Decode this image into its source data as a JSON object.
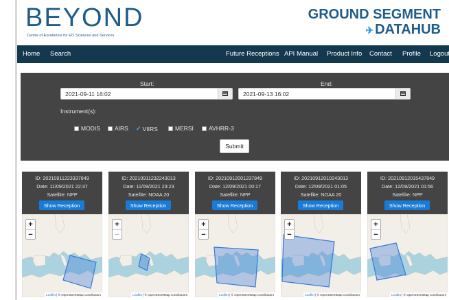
{
  "header": {
    "logo_text": "BEYOND",
    "logo_subtitle": "Centre of Excellence for EO Sciences and Services",
    "brand_line1": "GROUND SEGMENT",
    "brand_line2": "DATAHUB"
  },
  "nav": {
    "left": [
      "Home",
      "Search"
    ],
    "right": [
      "Future Receptions",
      "API Manual",
      "Product Info",
      "Contact",
      "Profile",
      "Logout"
    ]
  },
  "search": {
    "start_label": "Start:",
    "start_value": "2021-09-11 16:02",
    "end_label": "End:",
    "end_value": "2021-09-13 16:02",
    "instruments_label": "Instrument(s):",
    "instruments": [
      {
        "label": "MODIS",
        "checked": false
      },
      {
        "label": "AIRS",
        "checked": false
      },
      {
        "label": "VIIRS",
        "checked": true
      },
      {
        "label": "MERSI",
        "checked": false
      },
      {
        "label": "AVHRR-3",
        "checked": false
      }
    ],
    "submit_label": "Submit"
  },
  "cards": [
    {
      "id": "ID: 20210911223337849",
      "date": "Date: 11/09/2021 22:37",
      "satellite": "Satellite: NPP",
      "button": "Show Reception",
      "map_attribution_leaflet": "Leaflet",
      "map_attribution_osm": "© OpenStreetMap contributors"
    },
    {
      "id": "ID: 20210911232243013",
      "date": "Date: 11/09/2021 23:23",
      "satellite": "Satellite: NOAA 20",
      "button": "Show Reception",
      "map_attribution_leaflet": "Leaflet",
      "map_attribution_osm": "© OpenStreetMap contributors"
    },
    {
      "id": "ID: 20210912001237849",
      "date": "Date: 12/09/2021 00:17",
      "satellite": "Satellite: NPP",
      "button": "Show Reception",
      "map_attribution_leaflet": "Leaflet",
      "map_attribution_osm": "© OpenStreetMap contributors"
    },
    {
      "id": "ID: 20210912010243013",
      "date": "Date: 12/09/2021 01:05",
      "satellite": "Satellite: NOAA 20",
      "button": "Show Reception",
      "map_attribution_leaflet": "Leaflet",
      "map_attribution_osm": "© OpenStreetMap contributors"
    },
    {
      "id": "ID: 20210912015437849",
      "date": "Date: 12/09/2021 01:56",
      "satellite": "Satellite: NPP",
      "button": "Show Reception",
      "map_attribution_leaflet": "Leaflet",
      "map_attribution_osm": "© OpenStreetMap contributors"
    }
  ],
  "map_controls": {
    "zoom_in": "+",
    "zoom_out": "−"
  },
  "colors": {
    "nav_bg": "#14394f",
    "panel_bg": "#444444",
    "brand": "#1f5c8a",
    "button_blue": "#1a7bd6",
    "sea": "#aad3df",
    "land": "#f2efe9",
    "footprint": "#3a78d8"
  }
}
